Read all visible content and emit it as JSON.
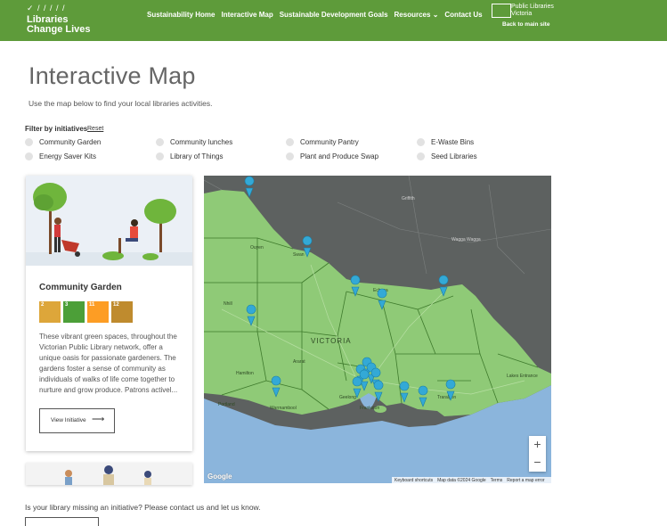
{
  "header": {
    "logo_line1": "Libraries",
    "logo_line2": "Change Lives",
    "nav": [
      "Sustainability Home",
      "Interactive Map",
      "Sustainable Development Goals",
      "Resources",
      "Contact Us"
    ],
    "partner_name_line1": "Public Libraries",
    "partner_name_line2": "Victoria",
    "back_link": "Back to main site"
  },
  "page": {
    "title": "Interactive Map",
    "subtitle": "Use the map below to find your local libraries activities."
  },
  "filter": {
    "heading": "Filter by initiatives",
    "reset": "Reset",
    "options": [
      "Community Garden",
      "Community lunches",
      "Community Pantry",
      "E-Waste Bins",
      "Energy Saver Kits",
      "Library of Things",
      "Plant and Produce Swap",
      "Seed Libraries"
    ]
  },
  "card": {
    "title": "Community Garden",
    "description": "These vibrant green spaces, throughout the Victorian Public Library network, offer a unique oasis for passionate gardeners. The gardens foster a sense of community as individuals of walks of life come together to nurture and grow produce. Patrons activel...",
    "button_label": "View Initiative",
    "sdg_badges": [
      {
        "number": "2",
        "color": "#dda63a"
      },
      {
        "number": "3",
        "color": "#4c9f38"
      },
      {
        "number": "11",
        "color": "#fd9d24"
      },
      {
        "number": "12",
        "color": "#bf8b2e"
      }
    ]
  },
  "map": {
    "labels": [
      "VICTORIA",
      "Ouyen",
      "Swan",
      "Nhill",
      "Hamilton",
      "Warrnambool",
      "Portland",
      "Echuca",
      "Wagga Wagga",
      "Griffith",
      "Lakes Entrance",
      "Traralgon",
      "Frankston",
      "Geelong",
      "Ararat"
    ],
    "zoom_in": "+",
    "zoom_out": "−",
    "attribution": [
      "Keyboard shortcuts",
      "Map data ©2024 Google",
      "Terms",
      "Report a map error"
    ],
    "google_mark": "Google"
  },
  "footer": {
    "missing_text": "Is your library missing an initiative? Please contact us and let us know."
  },
  "colors": {
    "header_green": "#5e9b3a",
    "victoria_green": "#8fca77",
    "nsw_dark": "#5d6160",
    "ocean": "#8bb5dc",
    "marker_blue": "#33a9d6"
  },
  "icons": [
    "tick-marks-logo-icon",
    "chevron-down-icon",
    "arrow-right-icon",
    "map-marker-icon"
  ]
}
